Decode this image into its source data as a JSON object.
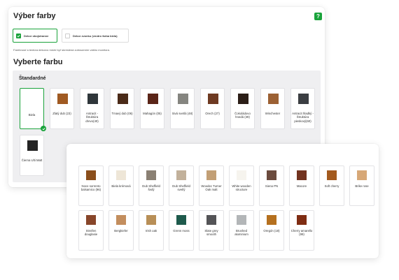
{
  "header": {
    "title": "Výber farby",
    "help_label": "?"
  },
  "color_mode": {
    "options": [
      {
        "label": "Dekor obojstranne",
        "selected": true
      },
      {
        "label": "Dekor zvonku (vnútro farba biela)",
        "selected": false
      }
    ]
  },
  "note": "Farebnosť a textúra dekorov môže byť skreslená zobrazením vášho monitora.",
  "section_title": "Vyberte farbu",
  "standard_group": {
    "title": "Štandardné",
    "items": [
      {
        "label": "Biela",
        "color": "#ffffff",
        "selected": true
      },
      {
        "label": "Zlatý dub (23)",
        "color": "#a05a22"
      },
      {
        "label": "Antracit - Štruktúra drevo(40)",
        "color": "#2f363a"
      },
      {
        "label": "Tmavý dub (06)",
        "color": "#4a2a18"
      },
      {
        "label": "Mahagón (05)",
        "color": "#5a2518"
      },
      {
        "label": "Sivá svetlá (48)",
        "color": "#858580"
      },
      {
        "label": "Orech (27)",
        "color": "#6e3a22"
      },
      {
        "label": "Čokoládovo hnedá (39)",
        "color": "#2b1e17"
      },
      {
        "label": "Winchester",
        "color": "#9c6134"
      },
      {
        "label": "Antracit hladký - Štruktúra pieskový(60)",
        "color": "#3b3e42"
      },
      {
        "label": "Čierna Ulti Matt",
        "color": "#242424"
      }
    ]
  },
  "extended_group": {
    "items": [
      {
        "label": "Noce sorrento balsamico (96)",
        "color": "#8b4f1c"
      },
      {
        "label": "Biela krémová",
        "color": "#eee6d7"
      },
      {
        "label": "Dub Sheffield šedý",
        "color": "#8a8073"
      },
      {
        "label": "Dub Sheffield svetlý",
        "color": "#c2b19b"
      },
      {
        "label": "Woodec Turner Oak malt",
        "color": "#c29f75"
      },
      {
        "label": "White wooden structure",
        "color": "#f6f4ee"
      },
      {
        "label": "Siena PN",
        "color": "#6b4b3e"
      },
      {
        "label": "Macore",
        "color": "#72331f"
      },
      {
        "label": "Soft cherry",
        "color": "#a35a1e"
      },
      {
        "label": "Brike rose",
        "color": "#d7a877"
      },
      {
        "label": "Streifen douglasie",
        "color": "#88462a"
      },
      {
        "label": "Bergkiefer",
        "color": "#c38e5e"
      },
      {
        "label": "Irish oak",
        "color": "#b88f57"
      },
      {
        "label": "Grenn moss",
        "color": "#1e5a4c"
      },
      {
        "label": "Slate grey smooth",
        "color": "#545457"
      },
      {
        "label": "Brushed aluminium",
        "color": "#b3b6b8"
      },
      {
        "label": "Oregón (18)",
        "color": "#b5701f"
      },
      {
        "label": "Cherry amarello (99)",
        "color": "#7f2d13"
      }
    ]
  }
}
